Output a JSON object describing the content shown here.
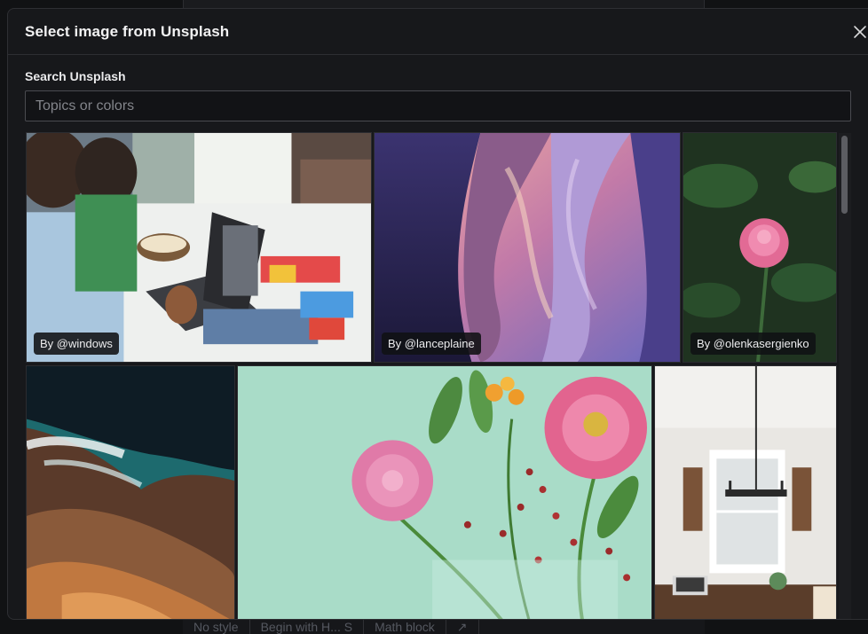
{
  "background": {
    "bottom_bar": [
      "No style",
      "Begin with H... S",
      "Math block",
      "↗"
    ]
  },
  "modal": {
    "title": "Select image from Unsplash",
    "close_icon": "close-icon"
  },
  "search": {
    "label": "Search Unsplash",
    "placeholder": "Topics or colors",
    "value": ""
  },
  "images": [
    {
      "credit": "By @windows",
      "subject": "people-laptop-couch"
    },
    {
      "credit": "By @lanceplaine",
      "subject": "canyon-rock-waves"
    },
    {
      "credit": "By @olenkasergienko",
      "subject": "pink-peony"
    },
    {
      "credit": "",
      "subject": "rocky-coastline"
    },
    {
      "credit": "",
      "subject": "pink-gerbera-bouquet"
    },
    {
      "credit": "",
      "subject": "dining-room-window"
    }
  ],
  "colors": {
    "modal_bg": "#17181b",
    "border": "#2e2f33",
    "text": "#f2f2f3"
  }
}
